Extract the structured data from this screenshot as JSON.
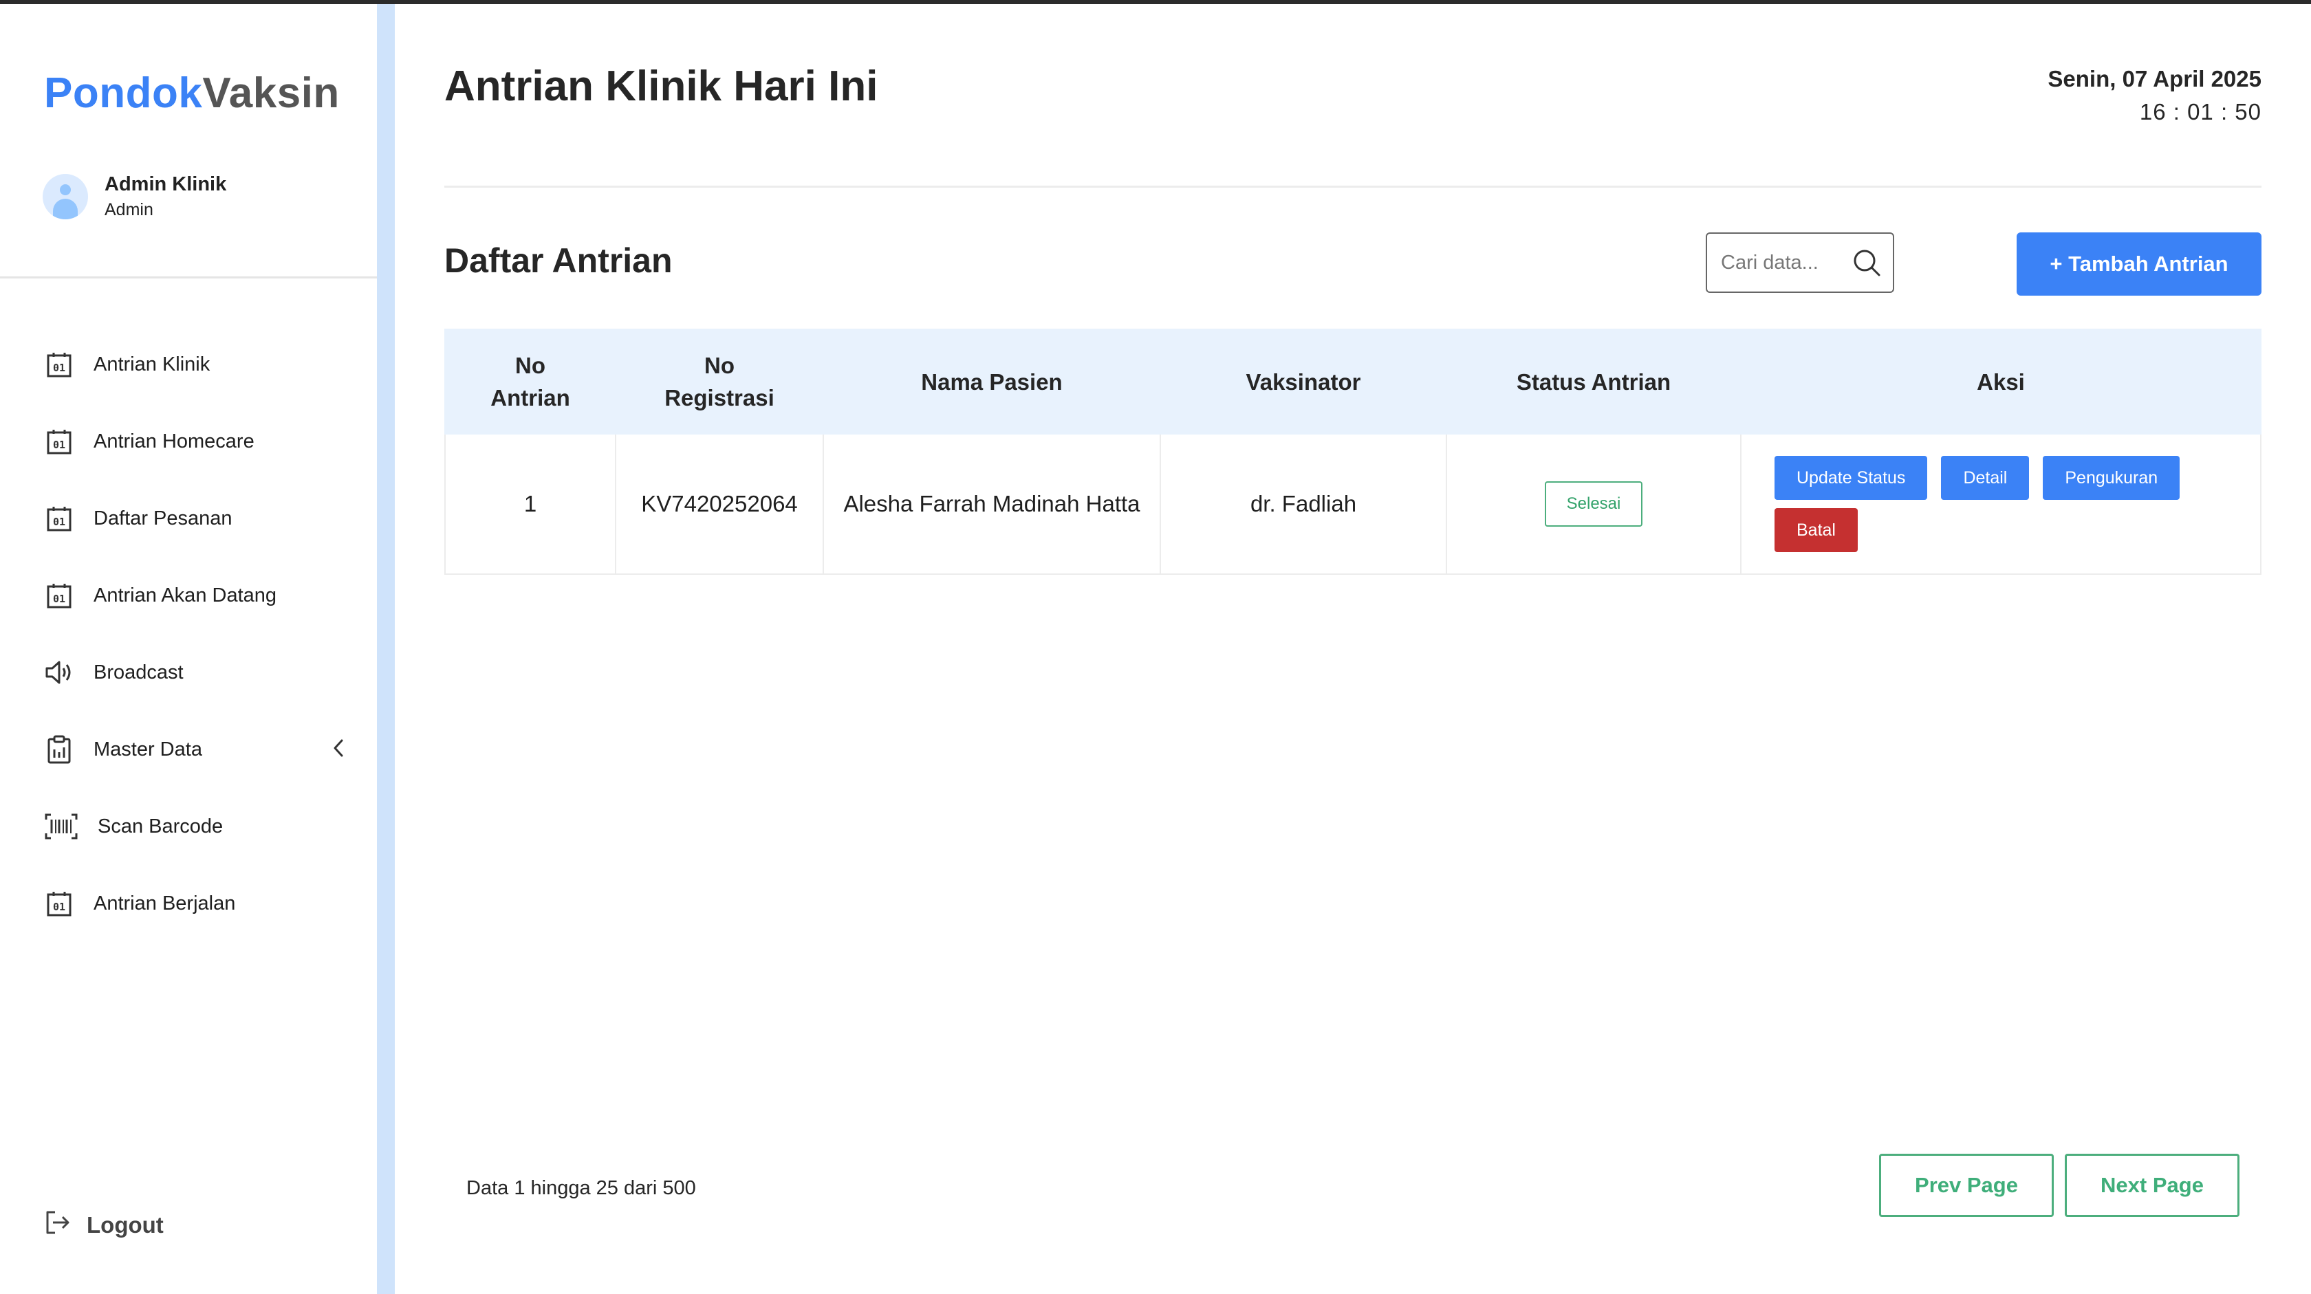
{
  "app": {
    "brand_part1": "Pondok",
    "brand_part2": "Vaksin"
  },
  "user": {
    "name": "Admin Klinik",
    "role": "Admin"
  },
  "sidebar": {
    "items": [
      {
        "label": "Antrian Klinik",
        "icon": "queue-number-icon"
      },
      {
        "label": "Antrian Homecare",
        "icon": "queue-number-icon"
      },
      {
        "label": "Daftar Pesanan",
        "icon": "queue-number-icon"
      },
      {
        "label": "Antrian Akan Datang",
        "icon": "queue-number-icon"
      },
      {
        "label": "Broadcast",
        "icon": "speaker-icon"
      },
      {
        "label": "Master Data",
        "icon": "clipboard-icon"
      },
      {
        "label": "Scan Barcode",
        "icon": "barcode-icon"
      },
      {
        "label": "Antrian Berjalan",
        "icon": "queue-number-icon"
      }
    ],
    "logout_label": "Logout"
  },
  "header": {
    "title": "Antrian Klinik Hari Ini",
    "date": "Senin, 07 April 2025",
    "time": "16 : 01 : 50"
  },
  "section": {
    "title": "Daftar Antrian",
    "search_placeholder": "Cari data...",
    "add_button": "+ Tambah Antrian"
  },
  "table": {
    "headers": {
      "no_antrian_1": "No",
      "no_antrian_2": "Antrian",
      "no_registrasi_1": "No",
      "no_registrasi_2": "Registrasi",
      "nama_pasien": "Nama Pasien",
      "vaksinator": "Vaksinator",
      "status_antrian": "Status Antrian",
      "aksi": "Aksi"
    },
    "rows": [
      {
        "no_antrian": "1",
        "no_registrasi": "KV7420252064",
        "nama_pasien": "Alesha Farrah Madinah Hatta",
        "vaksinator": "dr. Fadliah",
        "status": "Selesai",
        "actions": {
          "update_status": "Update Status",
          "detail": "Detail",
          "pengukuran": "Pengukuran",
          "batal": "Batal"
        }
      }
    ]
  },
  "footer": {
    "info": "Data 1 hingga 25 dari 500",
    "prev": "Prev Page",
    "next": "Next Page"
  },
  "colors": {
    "primary": "#3b82f6",
    "danger": "#c53030",
    "success": "#4cae7d",
    "header_bg": "#e8f2fd"
  }
}
